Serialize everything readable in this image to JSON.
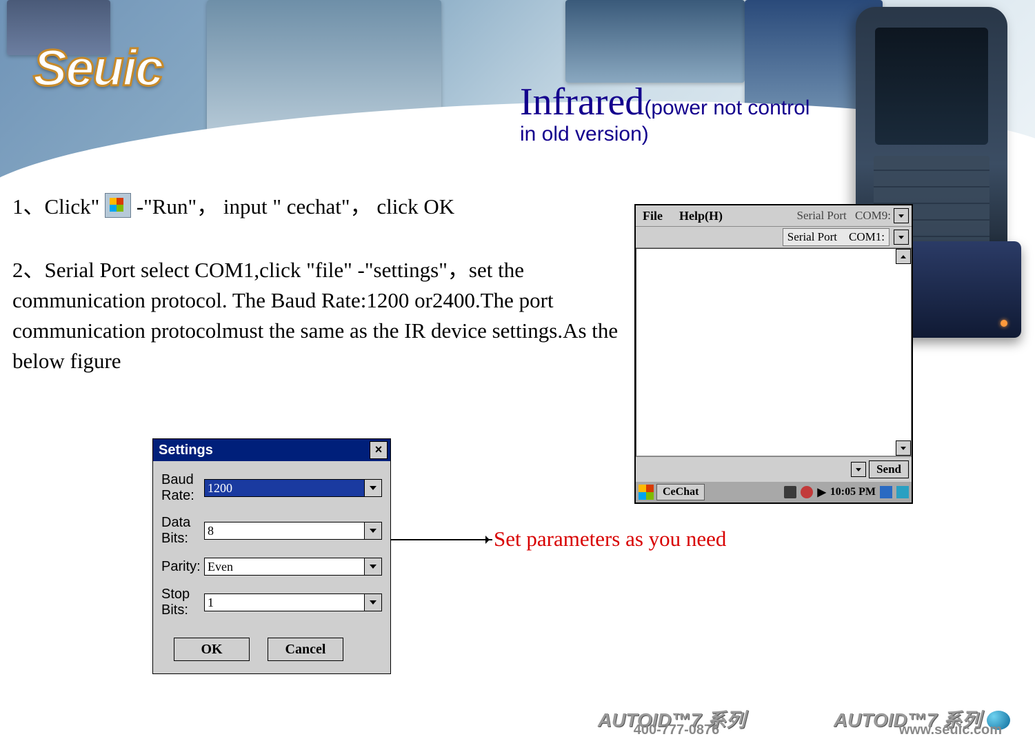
{
  "logo": "Seuic",
  "heading": {
    "main": "Infrared",
    "sub_open": "(",
    "sub_text": "power not control in old version",
    "sub_close": ")"
  },
  "step1": {
    "prefix": "1、Click\"",
    "after_icon": "-\"Run\"， input \" cechat\"， click OK"
  },
  "step2": "2、Serial Port select COM1,click \"file\" -\"settings\"，set the communication protocol. The Baud Rate:1200 or2400.The port communication protocolmust the same as the IR device settings.As the below figure",
  "annotation": "Set parameters as you need",
  "settings_dialog": {
    "title": "Settings",
    "close": "×",
    "fields": {
      "baud_label": "Baud Rate:",
      "baud_value": "1200",
      "databits_label": "Data Bits:",
      "databits_value": "8",
      "parity_label": "Parity:",
      "parity_value": "Even",
      "stopbits_label": "Stop Bits:",
      "stopbits_value": "1"
    },
    "ok": "OK",
    "cancel": "Cancel"
  },
  "cechat_window": {
    "menu_file": "File",
    "menu_help": "Help(H)",
    "serial_port_top_label": "Serial Port",
    "serial_port_top_value": "COM9:",
    "serial_port_sub_label": "Serial Port",
    "serial_port_sub_value": "COM1:",
    "send": "Send",
    "task_name": "CeChat",
    "clock": "10:05 PM",
    "tray_play": "▶"
  },
  "footer": {
    "product": "AUTOID™7 系列",
    "phone": "400-777-0876",
    "url": "www.seuic.com"
  }
}
